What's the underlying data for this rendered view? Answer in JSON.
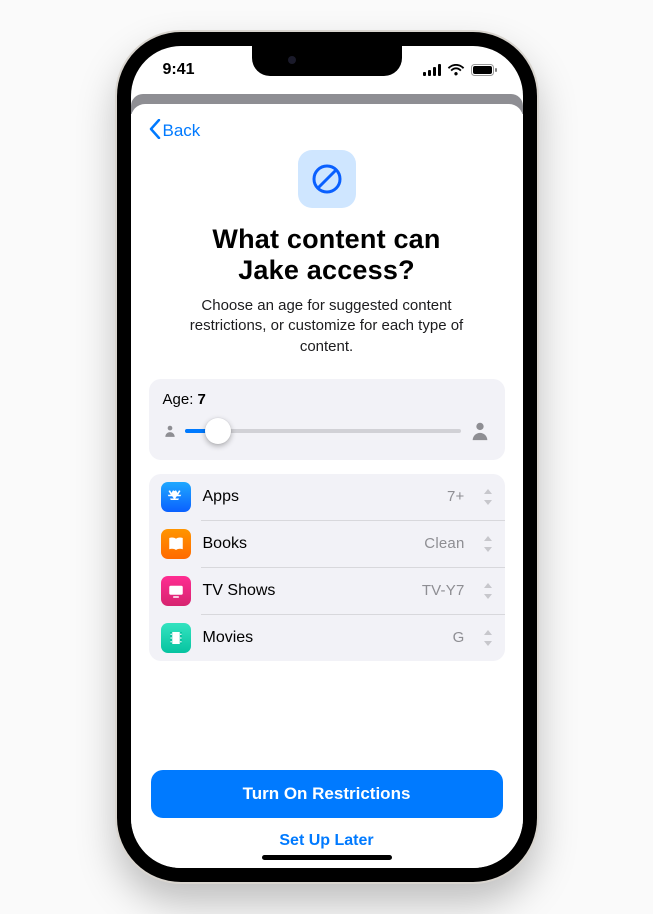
{
  "status": {
    "time": "9:41"
  },
  "nav": {
    "back_label": "Back"
  },
  "hero": {
    "title_line1": "What content can",
    "title_line2": "Jake access?",
    "subtitle": "Choose an age for suggested content restrictions, or customize for each type of content."
  },
  "age": {
    "label_prefix": "Age: ",
    "value": "7",
    "percent": 12
  },
  "content": {
    "rows": [
      {
        "icon": "appstore",
        "color": "linear-gradient(180deg,#1fa8ff,#0a60ff)",
        "label": "Apps",
        "value": "7+"
      },
      {
        "icon": "books",
        "color": "linear-gradient(180deg,#ff9500,#ff6a00)",
        "label": "Books",
        "value": "Clean"
      },
      {
        "icon": "tv",
        "color": "linear-gradient(180deg,#ff2d92,#d6246f)",
        "label": "TV Shows",
        "value": "TV-Y7"
      },
      {
        "icon": "movies",
        "color": "linear-gradient(180deg,#34e3c0,#06c3a0)",
        "label": "Movies",
        "value": "G"
      }
    ]
  },
  "footer": {
    "primary": "Turn On Restrictions",
    "secondary": "Set Up Later"
  }
}
